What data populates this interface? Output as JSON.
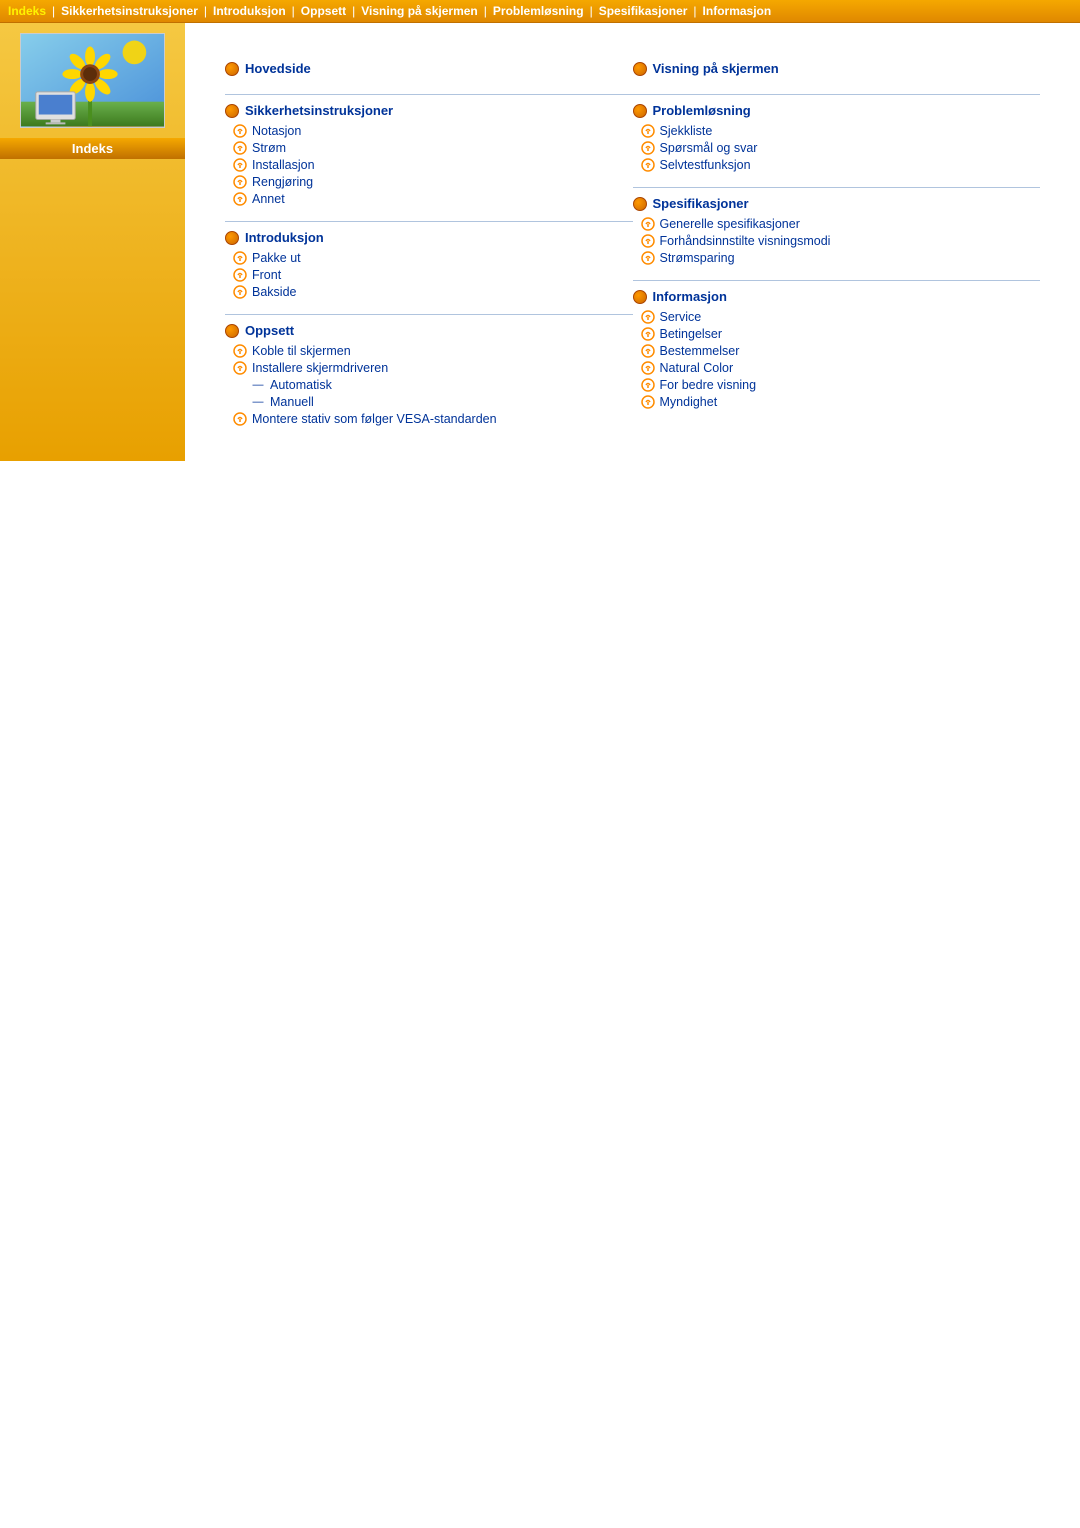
{
  "topnav": {
    "items": [
      {
        "label": "Indeks",
        "active": true
      },
      {
        "label": "Sikkerhetsinstruksjoner",
        "active": false
      },
      {
        "label": "Introduksjon",
        "active": false
      },
      {
        "label": "Oppsett",
        "active": false
      },
      {
        "label": "Visning på skjermen",
        "active": false
      },
      {
        "label": "Problemløsning",
        "active": false
      },
      {
        "label": "Spesifikasjoner",
        "active": false
      },
      {
        "label": "Informasjon",
        "active": false
      }
    ]
  },
  "sidebar": {
    "label": "Indeks"
  },
  "sections": {
    "col1": [
      {
        "title": "Hovedside",
        "subitems": []
      },
      {
        "title": "Sikkerhetsinstruksjoner",
        "subitems": [
          {
            "label": "Notasjon",
            "type": "g"
          },
          {
            "label": "Strøm",
            "type": "g"
          },
          {
            "label": "Installasjon",
            "type": "g"
          },
          {
            "label": "Rengjøring",
            "type": "g"
          },
          {
            "label": "Annet",
            "type": "g"
          }
        ]
      },
      {
        "title": "Introduksjon",
        "subitems": [
          {
            "label": "Pakke ut",
            "type": "g"
          },
          {
            "label": "Front",
            "type": "g"
          },
          {
            "label": "Bakside",
            "type": "g"
          }
        ]
      },
      {
        "title": "Oppsett",
        "subitems": [
          {
            "label": "Koble til skjermen",
            "type": "g"
          },
          {
            "label": "Installere skjermdriveren",
            "type": "g"
          },
          {
            "label": "Automatisk",
            "type": "dash"
          },
          {
            "label": "Manuell",
            "type": "dash"
          },
          {
            "label": "Montere stativ som følger VESA-standarden",
            "type": "g"
          }
        ]
      }
    ],
    "col2": [
      {
        "title": "Visning på skjermen",
        "subitems": []
      },
      {
        "title": "Problemløsning",
        "subitems": [
          {
            "label": "Sjekkliste",
            "type": "g"
          },
          {
            "label": "Spørsmål og svar",
            "type": "g"
          },
          {
            "label": "Selvtestfunksjon",
            "type": "g"
          }
        ]
      },
      {
        "title": "Spesifikasjoner",
        "subitems": [
          {
            "label": "Generelle spesifikasjoner",
            "type": "g"
          },
          {
            "label": "Forhåndsinnstilte visningsmodi",
            "type": "g"
          },
          {
            "label": "Strømsparing",
            "type": "g"
          }
        ]
      },
      {
        "title": "Informasjon",
        "subitems": [
          {
            "label": "Service",
            "type": "g"
          },
          {
            "label": "Betingelser",
            "type": "g"
          },
          {
            "label": "Bestemmelser",
            "type": "g"
          },
          {
            "label": "Natural Color",
            "type": "g"
          },
          {
            "label": "For bedre visning",
            "type": "g"
          },
          {
            "label": "Myndighet",
            "type": "g"
          }
        ]
      }
    ]
  }
}
